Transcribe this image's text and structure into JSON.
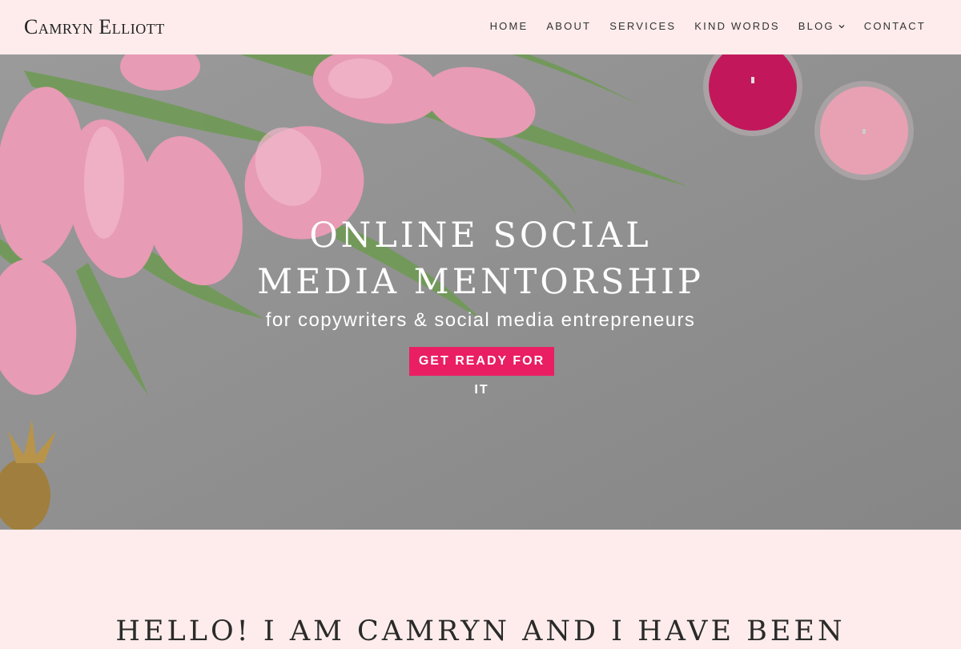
{
  "header": {
    "logo": "Camryn Elliott",
    "nav": [
      {
        "label": "HOME"
      },
      {
        "label": "ABOUT"
      },
      {
        "label": "SERVICES"
      },
      {
        "label": "KIND WORDS"
      },
      {
        "label": "BLOG",
        "has_dropdown": true
      },
      {
        "label": "CONTACT"
      }
    ]
  },
  "hero": {
    "title_line1": "ONLINE SOCIAL",
    "title_line2": "MEDIA MENTORSHIP",
    "subtitle": "for copywriters & social media entrepreneurs",
    "cta_label": "GET READY FOR IT",
    "image_content": [
      "pink-tulips",
      "candles",
      "gold-pineapple"
    ]
  },
  "intro": {
    "heading": "HELLO! I AM CAMRYN AND I HAVE BEEN"
  },
  "colors": {
    "background": "#fdeceb",
    "accent": "#e91e63",
    "hero_overlay": "#8a8a8a",
    "text_dark": "#222222"
  }
}
